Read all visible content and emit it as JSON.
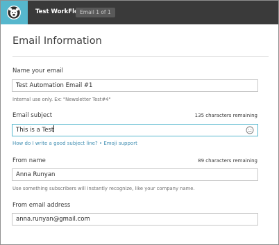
{
  "workflow": {
    "title": "Test WorkFlow",
    "badge": "Email 1 of 1"
  },
  "page": {
    "heading": "Email Information"
  },
  "form": {
    "name": {
      "label": "Name your email",
      "value": "Test Automation Email #1",
      "hint": "Internal use only. Ex: \"Newsletter Test#4\""
    },
    "subject": {
      "label": "Email subject",
      "counter": "135 characters remaining",
      "value": "This is a Test",
      "help_link": "How do I write a good subject line?",
      "separator": "•",
      "emoji_link": "Emoji support"
    },
    "from_name": {
      "label": "From name",
      "counter": "89 characters remaining",
      "value": "Anna Runyan",
      "hint": "Use something subscribers will instantly recognize, like your company name."
    },
    "from_email": {
      "label": "From email address",
      "value": "anna.runyan@gmail.com"
    }
  },
  "colors": {
    "topbar": "#3a3a3a",
    "logo_bg": "#56b7cd",
    "link": "#3d8cb0",
    "focus_border": "#56b7cd"
  },
  "icons": {
    "logo": "mailchimp-logo-icon",
    "emoji": "smiley-icon"
  }
}
